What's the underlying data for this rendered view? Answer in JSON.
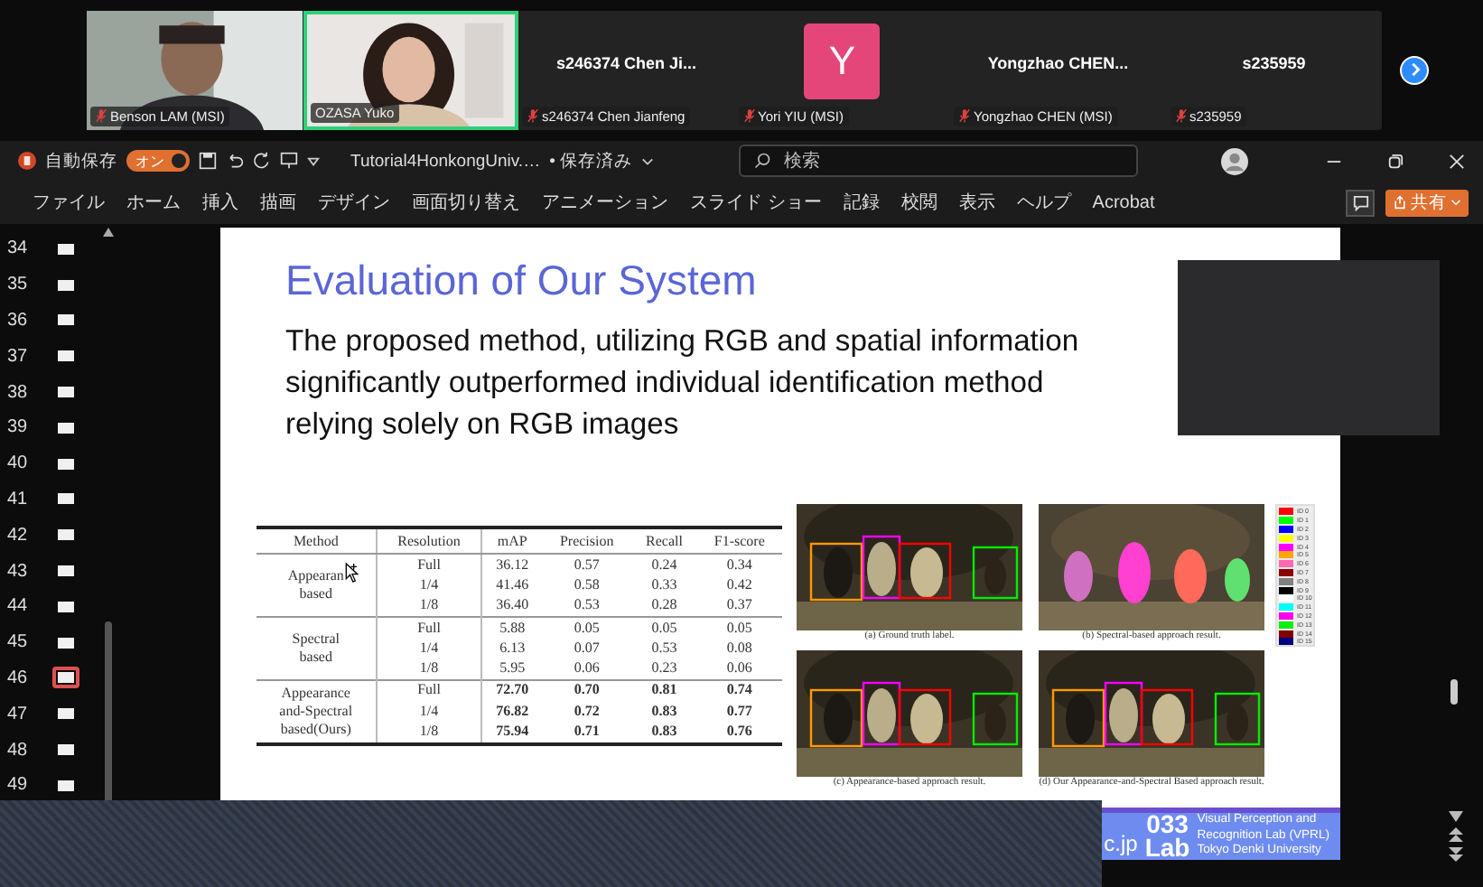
{
  "meeting": {
    "tiles": [
      {
        "kind": "video",
        "name": "Benson LAM (MSI)",
        "muted": true,
        "speaking": false
      },
      {
        "kind": "video",
        "name": "OZASA Yuko",
        "muted": false,
        "speaking": true
      },
      {
        "kind": "name",
        "display": "s246374 Chen Ji...",
        "name": "s246374 Chen Jianfeng",
        "muted": true,
        "speaking": false
      },
      {
        "kind": "avatar",
        "display": "Y",
        "name": "Yori YIU (MSI)",
        "muted": true,
        "speaking": false
      },
      {
        "kind": "name",
        "display": "Yongzhao  CHEN...",
        "name": "Yongzhao CHEN (MSI)",
        "muted": true,
        "speaking": false
      },
      {
        "kind": "name",
        "display": "s235959",
        "name": "s235959",
        "muted": true,
        "speaking": false
      }
    ]
  },
  "titlebar": {
    "autosave_label": "自動保存",
    "autosave_toggle": "オン",
    "autosave_on": true,
    "file_name": "Tutorial4HonkongUniv.…",
    "save_state": "• 保存済み",
    "search": {
      "placeholder": "検索"
    }
  },
  "ribbon": {
    "tabs": [
      "ファイル",
      "ホーム",
      "挿入",
      "描画",
      "デザイン",
      "画面切り替え",
      "アニメーション",
      "スライド ショー",
      "記録",
      "校閲",
      "表示",
      "ヘルプ",
      "Acrobat"
    ],
    "share": "共有"
  },
  "thumbnails": [
    {
      "number": "34",
      "selected": false
    },
    {
      "number": "35",
      "selected": false
    },
    {
      "number": "36",
      "selected": false
    },
    {
      "number": "37",
      "selected": false
    },
    {
      "number": "38",
      "selected": false
    },
    {
      "number": "39",
      "selected": false
    },
    {
      "number": "40",
      "selected": false
    },
    {
      "number": "41",
      "selected": false
    },
    {
      "number": "42",
      "selected": false
    },
    {
      "number": "43",
      "selected": false
    },
    {
      "number": "44",
      "selected": false
    },
    {
      "number": "45",
      "selected": false
    },
    {
      "number": "46",
      "selected": true
    },
    {
      "number": "47",
      "selected": false
    },
    {
      "number": "48",
      "selected": false
    },
    {
      "number": "49",
      "selected": false
    }
  ],
  "slide": {
    "title": "Evaluation of Our System",
    "body": [
      "The proposed method, utilizing RGB and spatial information",
      "significantly outperformed individual identification method",
      "relying solely on RGB images"
    ],
    "table": {
      "columns": [
        "Method",
        "Resolution",
        "mAP",
        "Precision",
        "Recall",
        "F1-score"
      ],
      "groups": [
        {
          "method": "Appearan\nbased",
          "bold": false,
          "rows": [
            [
              "Full",
              "36.12",
              "0.57",
              "0.24",
              "0.34"
            ],
            [
              "1/4",
              "41.46",
              "0.58",
              "0.33",
              "0.42"
            ],
            [
              "1/8",
              "36.40",
              "0.53",
              "0.28",
              "0.37"
            ]
          ]
        },
        {
          "method": "Spectral\nbased",
          "bold": false,
          "rows": [
            [
              "Full",
              "5.88",
              "0.05",
              "0.05",
              "0.05"
            ],
            [
              "1/4",
              "6.13",
              "0.07",
              "0.53",
              "0.08"
            ],
            [
              "1/8",
              "5.95",
              "0.06",
              "0.23",
              "0.06"
            ]
          ]
        },
        {
          "method": "Appearance\nand-Spectral\nbased(Ours)",
          "bold": true,
          "rows": [
            [
              "Full",
              "72.70",
              "0.70",
              "0.81",
              "0.74"
            ],
            [
              "1/4",
              "76.82",
              "0.72",
              "0.83",
              "0.77"
            ],
            [
              "1/8",
              "75.94",
              "0.71",
              "0.83",
              "0.76"
            ]
          ]
        }
      ]
    },
    "figures": [
      {
        "kind": "picture",
        "caption": "(a) Ground truth label."
      },
      {
        "kind": "picture",
        "caption": "(b) Spectral-based approach result."
      },
      {
        "kind": "picture",
        "caption": "(c) Appearance-based approach result."
      },
      {
        "kind": "picture",
        "caption": "(d) Our Appearance-and-Spectral Based approach result."
      }
    ],
    "legend": [
      {
        "label": "ID 0",
        "color": "#ff0000"
      },
      {
        "label": "ID 1",
        "color": "#00ff00"
      },
      {
        "label": "ID 2",
        "color": "#0000ff"
      },
      {
        "label": "ID 3",
        "color": "#ffff00"
      },
      {
        "label": "ID 4",
        "color": "#ff00ff"
      },
      {
        "label": "ID 5",
        "color": "#ffa500"
      },
      {
        "label": "ID 6",
        "color": "#ff69b4"
      },
      {
        "label": "ID 7",
        "color": "#8b0000"
      },
      {
        "label": "ID 8",
        "color": "#808080"
      },
      {
        "label": "ID 9",
        "color": "#000000"
      },
      {
        "label": "ID 10",
        "color": "#ffffff"
      },
      {
        "label": "ID 11",
        "color": "#00ffff"
      },
      {
        "label": "ID 12",
        "color": "#ff00ee"
      },
      {
        "label": "ID 13",
        "color": "#11ee11"
      },
      {
        "label": "ID 14",
        "color": "#800000"
      },
      {
        "label": "ID 15",
        "color": "#000080"
      }
    ],
    "footer": {
      "domain": "c.jp",
      "logo_number": "033",
      "logo_word": "Lab",
      "lab_lines": [
        "Visual Perception and",
        "Recognition Lab (VPRL)",
        "Tokyo Denki University"
      ]
    }
  }
}
